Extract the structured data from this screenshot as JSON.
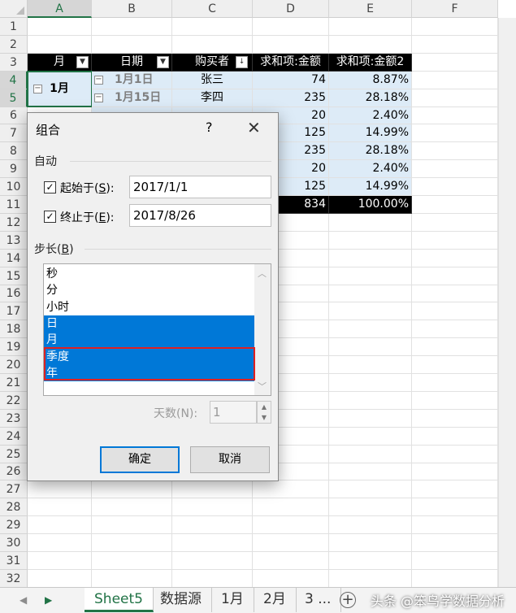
{
  "columns": [
    "A",
    "B",
    "C",
    "D",
    "E",
    "F"
  ],
  "rows": [
    "1",
    "2",
    "3",
    "4",
    "5",
    "6",
    "7",
    "8",
    "9",
    "10",
    "11",
    "12",
    "13",
    "14",
    "15",
    "16",
    "17",
    "18",
    "19",
    "20",
    "21",
    "22",
    "23",
    "24",
    "25",
    "26",
    "27",
    "28",
    "29",
    "30",
    "31",
    "32"
  ],
  "pivot": {
    "headers": [
      "月",
      "日期",
      "购买者",
      "求和项:金额",
      "求和项:金额2"
    ],
    "month_label": "1月",
    "rows": [
      {
        "date": "1月1日",
        "buyer": "张三",
        "amount": "74",
        "pct": "8.87%"
      },
      {
        "date": "1月15日",
        "buyer": "李四",
        "amount": "235",
        "pct": "28.18%"
      },
      {
        "date": "",
        "buyer": "",
        "amount": "20",
        "pct": "2.40%"
      },
      {
        "date": "",
        "buyer": "",
        "amount": "125",
        "pct": "14.99%"
      },
      {
        "date": "",
        "buyer": "",
        "amount": "235",
        "pct": "28.18%"
      },
      {
        "date": "",
        "buyer": "",
        "amount": "20",
        "pct": "2.40%"
      },
      {
        "date": "",
        "buyer": "",
        "amount": "125",
        "pct": "14.99%"
      }
    ],
    "total_amount": "834",
    "total_pct": "100.00%"
  },
  "dialog": {
    "title": "组合",
    "help": "?",
    "close": "✕",
    "auto_section": "自动",
    "start_label_pre": "起始于(",
    "start_label_key": "S",
    "start_label_post": "):",
    "start_value": "2017/1/1",
    "end_label_pre": "终止于(",
    "end_label_key": "E",
    "end_label_post": "):",
    "end_value": "2017/8/26",
    "step_label_pre": "步长(",
    "step_label_key": "B",
    "step_label_post": ")",
    "step_items": [
      {
        "label": "秒",
        "selected": false
      },
      {
        "label": "分",
        "selected": false
      },
      {
        "label": "小时",
        "selected": false
      },
      {
        "label": "日",
        "selected": true
      },
      {
        "label": "月",
        "selected": true
      },
      {
        "label": "季度",
        "selected": true
      },
      {
        "label": "年",
        "selected": true
      }
    ],
    "days_label": "天数(N):",
    "days_value": "1",
    "ok": "确定",
    "cancel": "取消"
  },
  "tabs": [
    "Sheet5",
    "数据源",
    "1月",
    "2月",
    "3 ..."
  ],
  "active_tab": "Sheet5",
  "watermark": "头条 @笨鸟学数据分析",
  "colors": {
    "excel_green": "#217346",
    "pivot_blue": "#ddebf7",
    "selection_blue": "#0078d7",
    "highlight_red": "#e02020"
  }
}
